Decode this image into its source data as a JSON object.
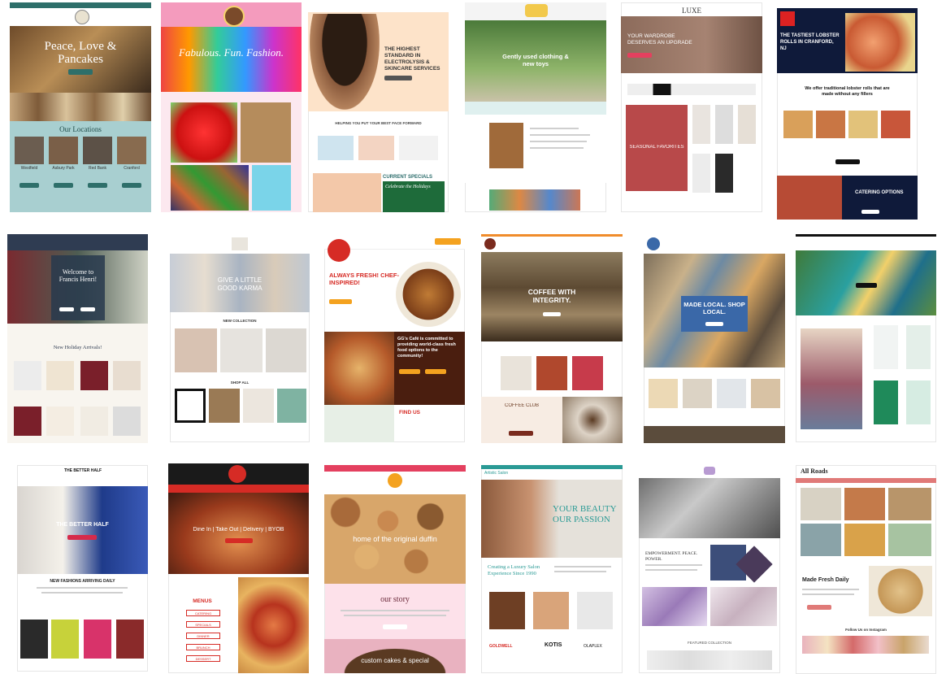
{
  "tiles": [
    {
      "id": "t1",
      "hero": "Peace, Love & Pancakes",
      "section": "Our Locations",
      "cards": [
        "Westfield",
        "Asbury Park",
        "Red Bank",
        "Cranford"
      ]
    },
    {
      "id": "t2",
      "hero": "Fabulous. Fun. Fashion."
    },
    {
      "id": "t3",
      "hero": "THE HIGHEST STANDARD IN ELECTROLYSIS & SKINCARE SERVICES",
      "section": "HELPING YOU PUT YOUR BEST FACE FORWARD",
      "specials": "CURRENT SPECIALS",
      "promo": "Celebrate the Holidays"
    },
    {
      "id": "t4",
      "hero": "Gently used clothing & new toys"
    },
    {
      "id": "t5",
      "logo": "LUXE",
      "hero": "YOUR WARDROBE DESERVES AN UPGRADE",
      "section": "SEASONAL FAVORITES"
    },
    {
      "id": "t6",
      "hero": "THE TASTIEST LOBSTER ROLLS IN CRANFORD, NJ",
      "section": "We offer traditional lobster rolls that are made without any fillers",
      "cta": "CATERING OPTIONS"
    },
    {
      "id": "t7",
      "hero": "Welcome to Francis Henri!",
      "section": "New Holiday Arrivals!"
    },
    {
      "id": "t8",
      "hero": "GIVE A LITTLE GOOD KARMA",
      "section": "NEW COLLECTION",
      "section2": "SHOP ALL"
    },
    {
      "id": "t9",
      "logo": "GG'S",
      "hero": "ALWAYS FRESH! CHEF-INSPIRED!",
      "section": "GG's Café is committed to providing world-class fresh food options to the community!",
      "cta": "FIND US"
    },
    {
      "id": "t10",
      "hero": "COFFEE WITH INTEGRITY.",
      "section": "COFFEE CLUB"
    },
    {
      "id": "t11",
      "hero": "MADE LOCAL. SHOP LOCAL."
    },
    {
      "id": "t12",
      "hero": ""
    },
    {
      "id": "t13",
      "logo": "THE BETTER HALF",
      "hero": "THE BETTER HALF",
      "section": "NEW FASHIONS ARRIVING DAILY"
    },
    {
      "id": "t14",
      "hero": "Dine In | Take Out | Delivery | BYOB",
      "section": "MENUS",
      "menu": [
        "CATERING",
        "SPECIALS",
        "DINNER",
        "BRUNCH",
        "DESSERT"
      ]
    },
    {
      "id": "t15",
      "hero": "home of the original duffin",
      "section": "our story",
      "cta": "custom cakes & special"
    },
    {
      "id": "t16",
      "logo": "Artistic Salon",
      "hero": "YOUR BEAUTY OUR PASSION",
      "section": "Creating a Luxury Salon Experience Since 1990",
      "brands": [
        "GOLDWELL",
        "KOTIS",
        "OLAPLEX"
      ]
    },
    {
      "id": "t17",
      "section": "EMPOWERMENT. PEACE. POWER.",
      "section2": "FEATURED COLLECTION"
    },
    {
      "id": "t18",
      "logo": "All Roads",
      "section": "Made Fresh Daily",
      "section2": "Follow Us on Instagram"
    }
  ]
}
